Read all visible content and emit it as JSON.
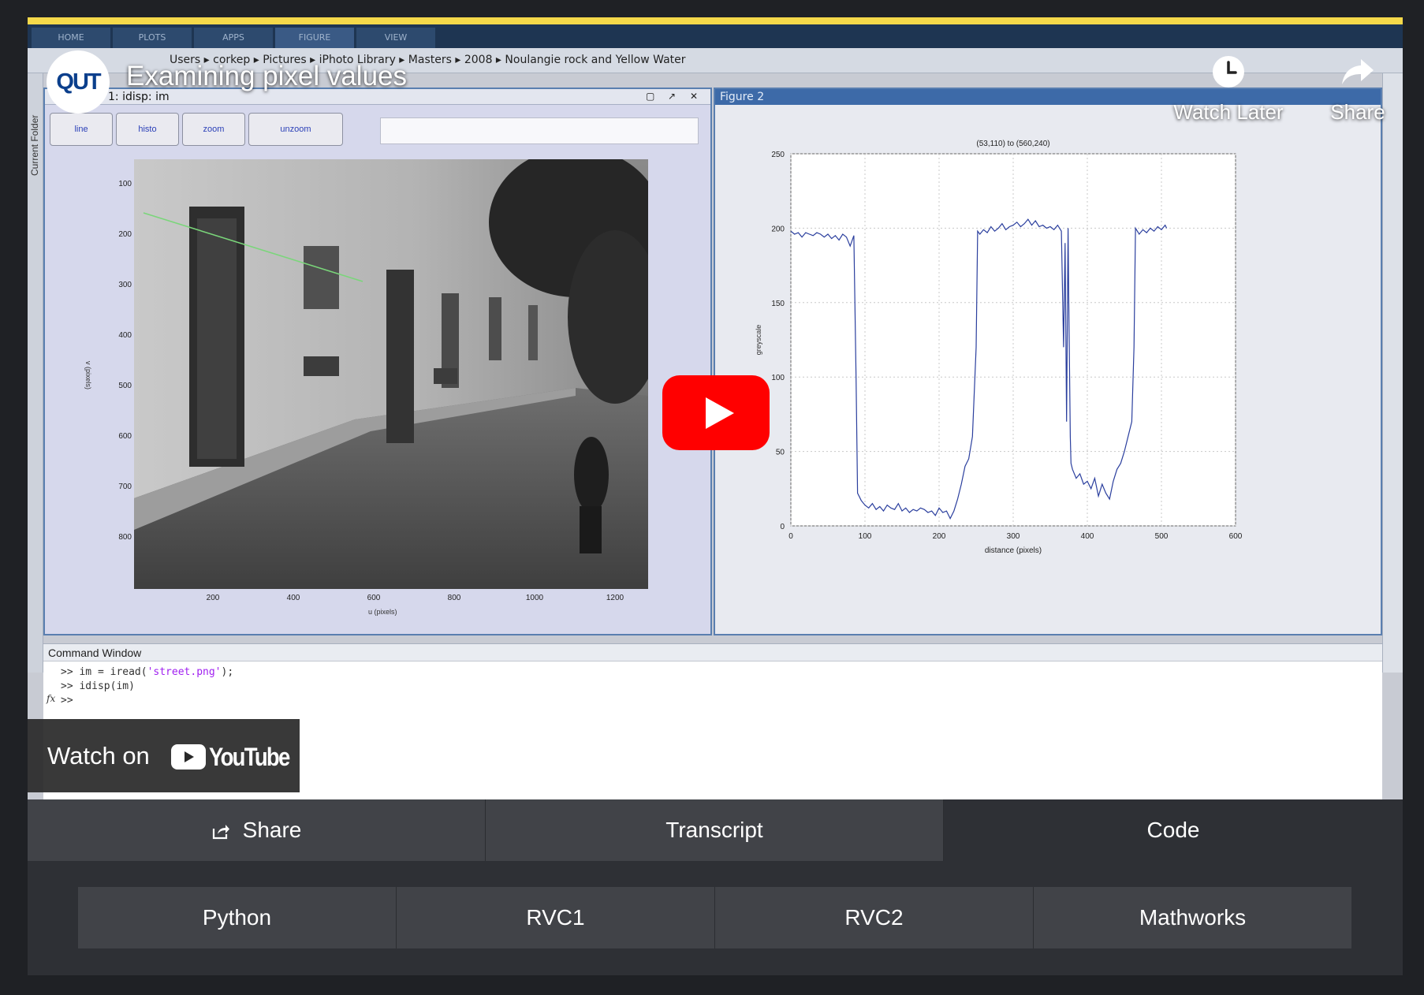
{
  "accent_color": "#f5d94a",
  "video": {
    "title": "Examining pixel values",
    "channel_logo_text": "QUT",
    "watch_later_label": "Watch Later",
    "share_label": "Share",
    "watch_on_label": "Watch on",
    "youtube_wordmark": "YouTube",
    "play_color": "#ff0000"
  },
  "matlab": {
    "tabs": [
      "HOME",
      "PLOTS",
      "APPS",
      "FIGURE",
      "VIEW"
    ],
    "path": [
      "Users",
      "corkep",
      "Pictures",
      "iPhoto Library",
      "Masters",
      "2008",
      "Noulangie rock and Yellow Water"
    ],
    "side_panel_label": "Current Folder",
    "figure1": {
      "title": "1: idisp: im",
      "buttons": [
        "line",
        "histo",
        "zoom",
        "unzoom"
      ],
      "y_ticks": [
        "100",
        "200",
        "300",
        "400",
        "500",
        "600",
        "700",
        "800"
      ],
      "x_ticks": [
        "200",
        "400",
        "600",
        "800",
        "1000",
        "1200"
      ],
      "xlabel": "u (pixels)",
      "ylabel": "v (pixels)"
    },
    "figure2": {
      "title": "Figure 2"
    },
    "command_window": {
      "title": "Command Window",
      "lines": [
        {
          "prompt": ">> ",
          "before": "im = iread(",
          "string": "'street.png'",
          "after": ");"
        },
        {
          "prompt": ">> ",
          "before": "idisp(im)",
          "string": "",
          "after": ""
        },
        {
          "prompt": ">> ",
          "before": "",
          "string": "",
          "after": ""
        }
      ],
      "fx_label": "fx"
    }
  },
  "chart_data": {
    "type": "line",
    "title": "(53,110) to (560,240)",
    "xlabel": "distance (pixels)",
    "ylabel": "greyscale",
    "xlim": [
      0,
      600
    ],
    "ylim": [
      0,
      250
    ],
    "x_ticks": [
      0,
      100,
      200,
      300,
      400,
      500,
      600
    ],
    "y_ticks": [
      0,
      50,
      100,
      150,
      200,
      250
    ],
    "grid": true,
    "series": [
      {
        "color": "#2b3f9e",
        "x": [
          0,
          5,
          10,
          15,
          20,
          25,
          30,
          35,
          40,
          45,
          50,
          55,
          60,
          65,
          70,
          75,
          80,
          85,
          88,
          90,
          92,
          95,
          100,
          105,
          110,
          115,
          120,
          125,
          130,
          135,
          140,
          145,
          150,
          155,
          160,
          165,
          170,
          175,
          180,
          185,
          190,
          195,
          200,
          205,
          210,
          215,
          220,
          225,
          230,
          235,
          240,
          245,
          250,
          252,
          255,
          260,
          265,
          270,
          275,
          280,
          285,
          290,
          295,
          300,
          305,
          310,
          315,
          320,
          325,
          330,
          335,
          340,
          345,
          350,
          355,
          360,
          365,
          368,
          370,
          372,
          374,
          375,
          377,
          378,
          380,
          385,
          390,
          395,
          400,
          405,
          410,
          415,
          420,
          425,
          430,
          435,
          440,
          445,
          450,
          455,
          460,
          463,
          465,
          470,
          475,
          480,
          485,
          490,
          495,
          500,
          505,
          507
        ],
        "y": [
          198,
          196,
          197,
          194,
          197,
          196,
          195,
          197,
          196,
          194,
          196,
          193,
          195,
          192,
          196,
          194,
          188,
          195,
          100,
          22,
          20,
          17,
          14,
          12,
          15,
          11,
          13,
          10,
          14,
          12,
          11,
          15,
          10,
          12,
          9,
          11,
          10,
          12,
          11,
          9,
          10,
          7,
          12,
          9,
          10,
          5,
          10,
          18,
          28,
          40,
          45,
          60,
          120,
          198,
          196,
          199,
          197,
          201,
          198,
          200,
          203,
          199,
          201,
          202,
          204,
          201,
          203,
          206,
          202,
          205,
          201,
          202,
          200,
          201,
          199,
          202,
          198,
          120,
          190,
          70,
          200,
          150,
          60,
          42,
          38,
          32,
          35,
          28,
          30,
          25,
          32,
          20,
          28,
          22,
          18,
          30,
          38,
          42,
          50,
          60,
          70,
          120,
          200,
          196,
          199,
          197,
          200,
          198,
          201,
          199,
          202,
          200
        ]
      }
    ]
  },
  "tabs": [
    {
      "label": "Share",
      "active": false
    },
    {
      "label": "Transcript",
      "active": false
    },
    {
      "label": "Code",
      "active": true
    }
  ],
  "code_tabs": [
    "Python",
    "RVC1",
    "RVC2",
    "Mathworks"
  ]
}
